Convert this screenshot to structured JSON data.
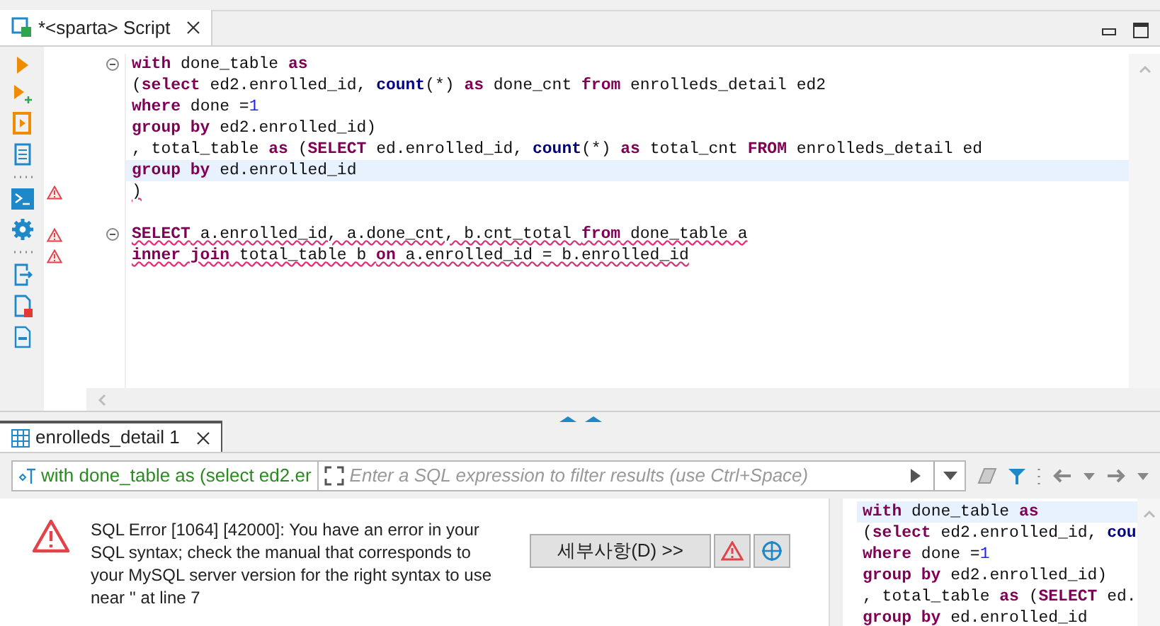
{
  "editor_tab": {
    "title": "*<sparta> Script",
    "selected": true
  },
  "code_lines": [
    {
      "marker": false,
      "fold": true,
      "current": false,
      "error": false,
      "tokens": [
        {
          "kind": "kw",
          "text": "with"
        },
        {
          "kind": "plain",
          "text": " done_table "
        },
        {
          "kind": "kw",
          "text": "as"
        }
      ]
    },
    {
      "marker": false,
      "fold": false,
      "current": false,
      "error": false,
      "tokens": [
        {
          "kind": "plain",
          "text": "("
        },
        {
          "kind": "kw",
          "text": "select"
        },
        {
          "kind": "plain",
          "text": " ed2.enrolled_id, "
        },
        {
          "kind": "fn",
          "text": "count"
        },
        {
          "kind": "plain",
          "text": "(*) "
        },
        {
          "kind": "kw",
          "text": "as"
        },
        {
          "kind": "plain",
          "text": " done_cnt "
        },
        {
          "kind": "kw",
          "text": "from"
        },
        {
          "kind": "plain",
          "text": " enrolleds_detail ed2"
        }
      ]
    },
    {
      "marker": false,
      "fold": false,
      "current": false,
      "error": false,
      "tokens": [
        {
          "kind": "kw",
          "text": "where"
        },
        {
          "kind": "plain",
          "text": " done ="
        },
        {
          "kind": "num",
          "text": "1"
        }
      ]
    },
    {
      "marker": false,
      "fold": false,
      "current": false,
      "error": false,
      "tokens": [
        {
          "kind": "kw",
          "text": "group by"
        },
        {
          "kind": "plain",
          "text": " ed2.enrolled_id)"
        }
      ]
    },
    {
      "marker": false,
      "fold": false,
      "current": false,
      "error": false,
      "tokens": [
        {
          "kind": "plain",
          "text": ", total_table "
        },
        {
          "kind": "kw",
          "text": "as"
        },
        {
          "kind": "plain",
          "text": " ("
        },
        {
          "kind": "kw",
          "text": "SELECT"
        },
        {
          "kind": "plain",
          "text": " ed.enrolled_id, "
        },
        {
          "kind": "fn",
          "text": "count"
        },
        {
          "kind": "plain",
          "text": "(*) "
        },
        {
          "kind": "kw",
          "text": "as"
        },
        {
          "kind": "plain",
          "text": " total_cnt "
        },
        {
          "kind": "kw",
          "text": "FROM"
        },
        {
          "kind": "plain",
          "text": " enrolleds_detail ed"
        }
      ]
    },
    {
      "marker": false,
      "fold": false,
      "current": true,
      "error": false,
      "tokens": [
        {
          "kind": "kw",
          "text": "group by"
        },
        {
          "kind": "plain",
          "text": " ed.enrolled_id"
        }
      ]
    },
    {
      "marker": true,
      "fold": false,
      "current": false,
      "error": true,
      "tokens": [
        {
          "kind": "plain",
          "text": ")"
        }
      ]
    },
    {
      "blank_before": true,
      "marker": true,
      "fold": true,
      "current": false,
      "error": true,
      "tokens": [
        {
          "kind": "kw",
          "text": "SELECT"
        },
        {
          "kind": "plain",
          "text": " a.enrolled_id, a.done_cnt, b.cnt_total "
        },
        {
          "kind": "kw",
          "text": "from"
        },
        {
          "kind": "plain",
          "text": " done_table a"
        }
      ]
    },
    {
      "marker": true,
      "fold": false,
      "current": false,
      "error": true,
      "tokens": [
        {
          "kind": "kw",
          "text": "inner join"
        },
        {
          "kind": "plain",
          "text": " total_table b "
        },
        {
          "kind": "kw",
          "text": "on"
        },
        {
          "kind": "plain",
          "text": " a.enrolled_id = b.enrolled_id"
        }
      ]
    }
  ],
  "results_tab": {
    "title": "enrolleds_detail 1",
    "selected": true
  },
  "filter_bar": {
    "query": "with done_table as (select ed2.er",
    "placeholder": "Enter a SQL expression to filter results (use Ctrl+Space)"
  },
  "error": {
    "message": "SQL Error [1064] [42000]: You have an error in your SQL syntax; check the manual that corresponds to your MySQL server version for the right syntax to use near '' at line 7",
    "details_button": "세부사항(D) >>"
  },
  "query_preview": [
    {
      "current": true,
      "tokens": [
        {
          "kind": "kw",
          "text": "with"
        },
        {
          "kind": "plain",
          "text": " done_table "
        },
        {
          "kind": "kw",
          "text": "as"
        }
      ]
    },
    {
      "current": false,
      "tokens": [
        {
          "kind": "plain",
          "text": "("
        },
        {
          "kind": "kw",
          "text": "select"
        },
        {
          "kind": "plain",
          "text": " ed2.enrolled_id, "
        },
        {
          "kind": "fn",
          "text": "cou"
        }
      ]
    },
    {
      "current": false,
      "tokens": [
        {
          "kind": "kw",
          "text": "where"
        },
        {
          "kind": "plain",
          "text": " done ="
        },
        {
          "kind": "num",
          "text": "1"
        }
      ]
    },
    {
      "current": false,
      "tokens": [
        {
          "kind": "kw",
          "text": "group by"
        },
        {
          "kind": "plain",
          "text": " ed2.enrolled_id)"
        }
      ]
    },
    {
      "current": false,
      "tokens": [
        {
          "kind": "plain",
          "text": ", total_table "
        },
        {
          "kind": "kw",
          "text": "as"
        },
        {
          "kind": "plain",
          "text": " ("
        },
        {
          "kind": "kw",
          "text": "SELECT"
        },
        {
          "kind": "plain",
          "text": " ed."
        }
      ]
    },
    {
      "current": false,
      "tokens": [
        {
          "kind": "kw",
          "text": "group by"
        },
        {
          "kind": "plain",
          "text": " ed.enrolled_id"
        }
      ]
    }
  ]
}
